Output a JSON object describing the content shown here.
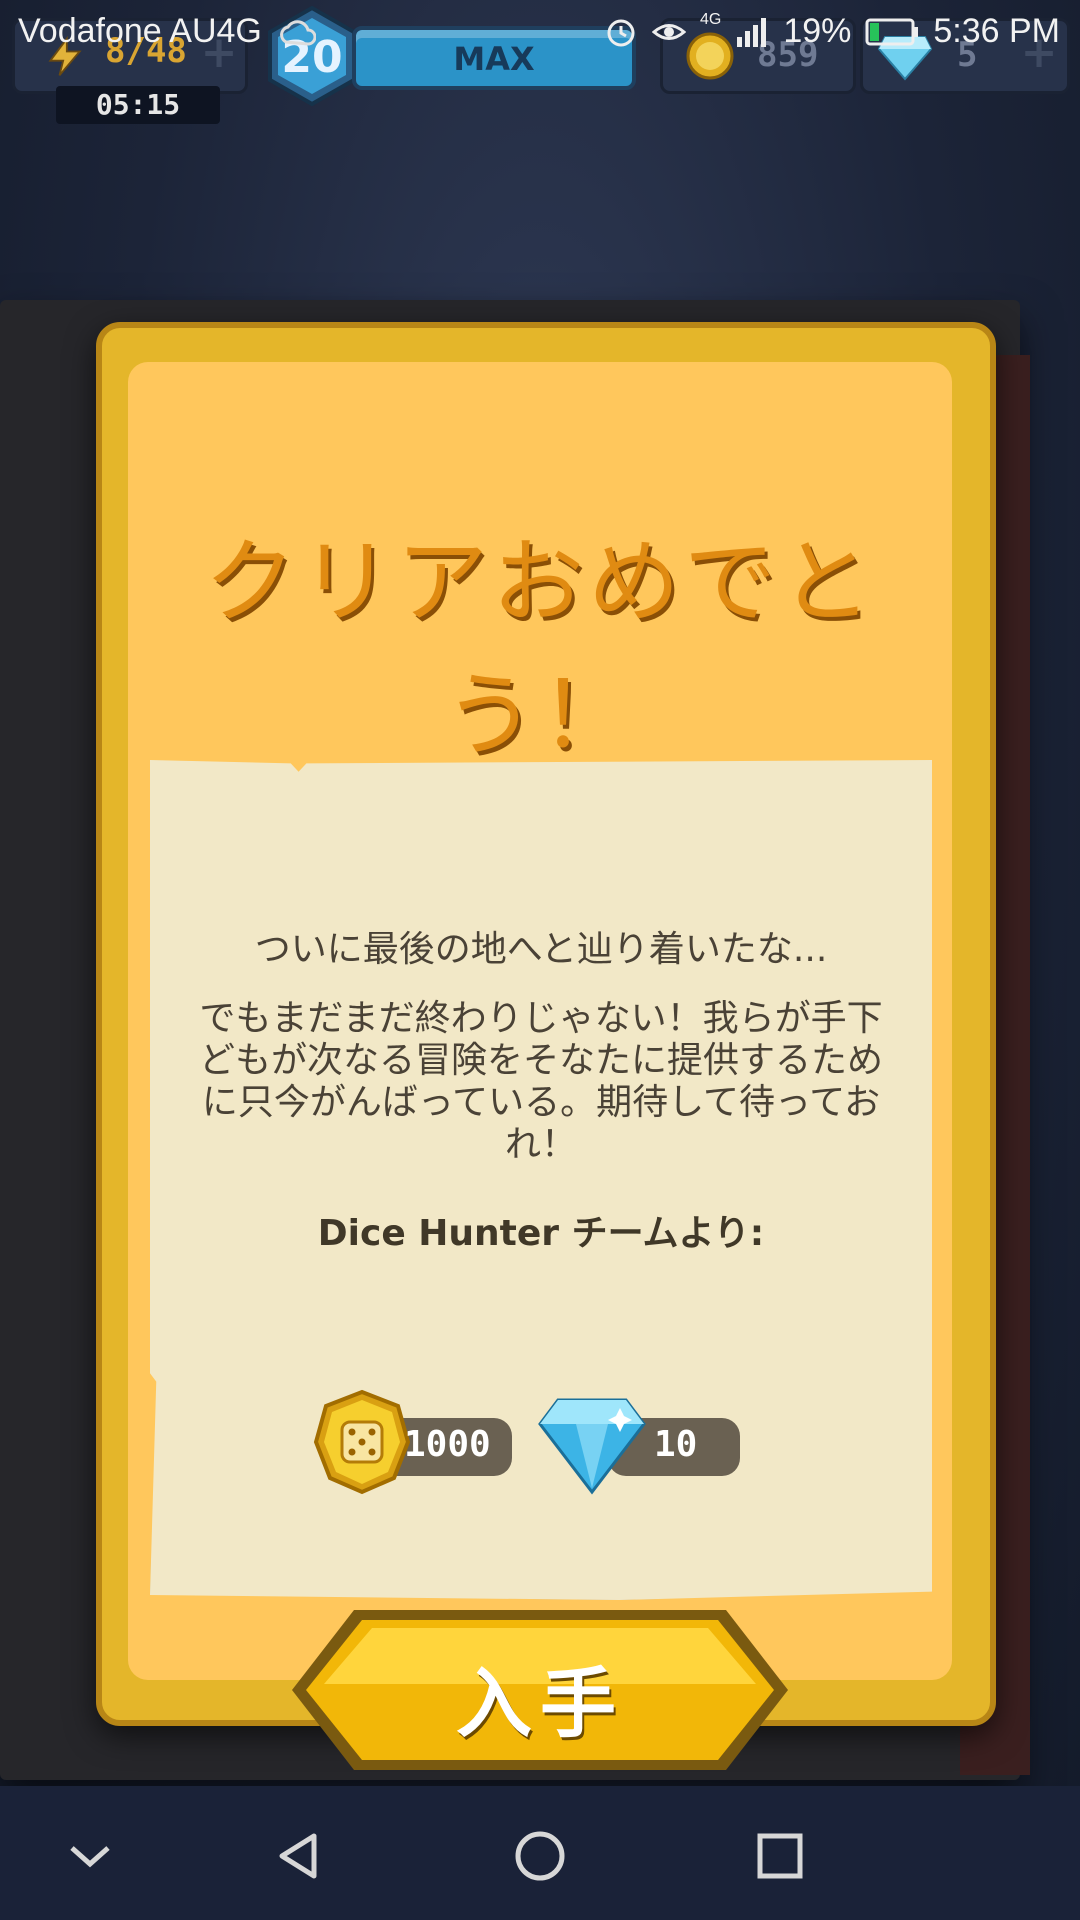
{
  "status_bar": {
    "carrier": "Vodafone AU4G",
    "network": "4G",
    "battery": "19%",
    "time": "5:36 PM",
    "icons": [
      "weather-icon",
      "alarm-icon",
      "eye-icon",
      "signal-icon",
      "battery-icon"
    ]
  },
  "hud": {
    "energy": "8/48",
    "timer": "05:15",
    "level": "20",
    "xp_label": "MAX",
    "coins": "859",
    "gems": "5"
  },
  "dialog": {
    "title": "クリアおめでとう！",
    "line1": "ついに最後の地へと辿り着いたな...",
    "paragraph_lines": [
      "でもまだまだ終わりじゃない！我らが手下",
      "どもが次なる冒険をそなたに提供するため",
      "に只今がんばっている。期待して待ってお",
      "れ！"
    ],
    "signoff": "Dice Hunter チームより:",
    "rewards": {
      "coins": "1000",
      "gems": "10"
    },
    "button_label": "入手"
  },
  "colors": {
    "panel": "#ffc75c",
    "frame": "#e4b62a",
    "title": "#e08b12",
    "paper": "#f2e8c7",
    "button": "#f6c21a"
  }
}
